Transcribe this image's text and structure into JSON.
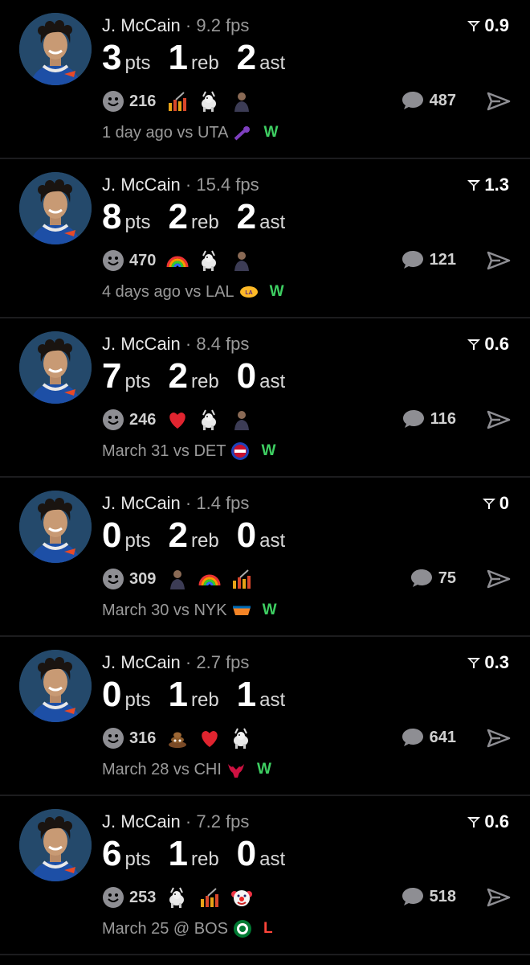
{
  "colors": {
    "win": "#3ecf62",
    "loss": "#ff453a",
    "muted": "#9a9a9a",
    "background": "#000000"
  },
  "icons": {
    "rating": "filter-funnel-icon",
    "reactions": "smiley-icon",
    "comments": "speech-bubble-icon",
    "share": "paper-plane-icon"
  },
  "games": [
    {
      "player": "J. McCain",
      "fps": "· 9.2 fps",
      "rating": "0.9",
      "pts": "3",
      "reb": "1",
      "ast": "2",
      "pts_label": "pts",
      "reb_label": "reb",
      "ast_label": "ast",
      "reactions": "216",
      "emojis": [
        "chart-icon",
        "goat-icon",
        "person-icon"
      ],
      "comments": "487",
      "game": "1 day ago vs UTA",
      "opponent_logo": "uta-logo",
      "result": "W"
    },
    {
      "player": "J. McCain",
      "fps": "· 15.4 fps",
      "rating": "1.3",
      "pts": "8",
      "reb": "2",
      "ast": "2",
      "pts_label": "pts",
      "reb_label": "reb",
      "ast_label": "ast",
      "reactions": "470",
      "emojis": [
        "rainbow-icon",
        "goat-icon",
        "person-icon"
      ],
      "comments": "121",
      "game": "4 days ago vs LAL",
      "opponent_logo": "lal-logo",
      "result": "W"
    },
    {
      "player": "J. McCain",
      "fps": "· 8.4 fps",
      "rating": "0.6",
      "pts": "7",
      "reb": "2",
      "ast": "0",
      "pts_label": "pts",
      "reb_label": "reb",
      "ast_label": "ast",
      "reactions": "246",
      "emojis": [
        "heart-icon",
        "goat-icon",
        "person-icon"
      ],
      "comments": "116",
      "game": "March 31 vs DET",
      "opponent_logo": "det-logo",
      "result": "W"
    },
    {
      "player": "J. McCain",
      "fps": "· 1.4 fps",
      "rating": "0",
      "pts": "0",
      "reb": "2",
      "ast": "0",
      "pts_label": "pts",
      "reb_label": "reb",
      "ast_label": "ast",
      "reactions": "309",
      "emojis": [
        "person-icon",
        "rainbow-icon",
        "chart-icon"
      ],
      "comments": "75",
      "game": "March 30 vs NYK",
      "opponent_logo": "nyk-logo",
      "result": "W"
    },
    {
      "player": "J. McCain",
      "fps": "· 2.7 fps",
      "rating": "0.3",
      "pts": "0",
      "reb": "1",
      "ast": "1",
      "pts_label": "pts",
      "reb_label": "reb",
      "ast_label": "ast",
      "reactions": "316",
      "emojis": [
        "poop-icon",
        "heart-icon",
        "goat-icon"
      ],
      "comments": "641",
      "game": "March 28 vs CHI",
      "opponent_logo": "chi-logo",
      "result": "W"
    },
    {
      "player": "J. McCain",
      "fps": "· 7.2 fps",
      "rating": "0.6",
      "pts": "6",
      "reb": "1",
      "ast": "0",
      "pts_label": "pts",
      "reb_label": "reb",
      "ast_label": "ast",
      "reactions": "253",
      "emojis": [
        "goat-icon",
        "chart-icon",
        "clown-icon"
      ],
      "comments": "518",
      "game": "March 25 @ BOS",
      "opponent_logo": "bos-logo",
      "result": "L"
    }
  ]
}
